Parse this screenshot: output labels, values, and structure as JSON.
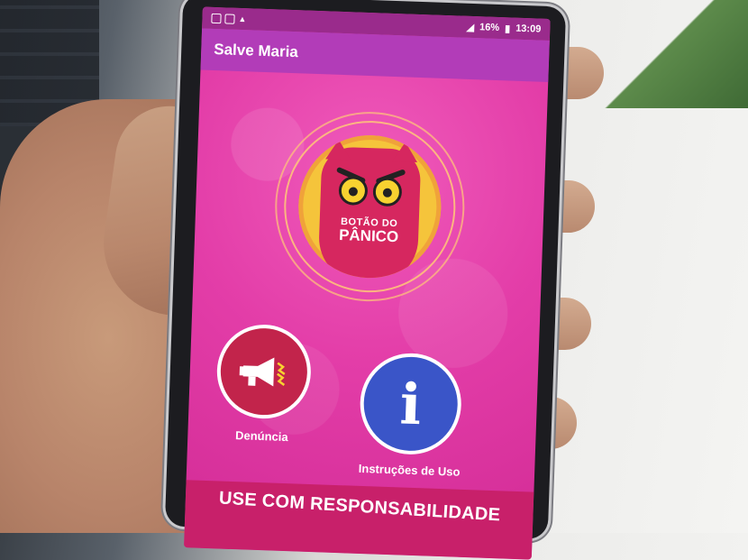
{
  "status_bar": {
    "battery": "16%",
    "time": "13:09"
  },
  "app_bar": {
    "title": "Salve Maria"
  },
  "panic_button": {
    "line1": "BOTÃO DO",
    "line2": "PÂNICO",
    "icon": "owl-icon"
  },
  "complaint_button": {
    "label": "Denúncia",
    "icon": "megaphone-icon"
  },
  "info_button": {
    "label": "Instruções de Uso",
    "icon": "info-icon",
    "glyph": "i"
  },
  "banner": {
    "text": "USE COM RESPONSABILIDADE"
  },
  "colors": {
    "screen_bg": "#e33da8",
    "app_bar": "#b23cb8",
    "panic_core": "#f5c43b",
    "owl": "#d6275f",
    "complaint": "#c2244b",
    "info": "#3a55c8",
    "banner": "#c8206a"
  }
}
